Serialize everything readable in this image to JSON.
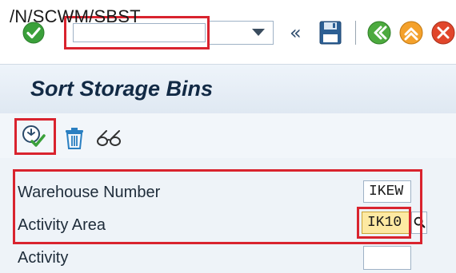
{
  "toolbar": {
    "command_value": "/N/SCWM/SBST",
    "nav_back_symbol": "«"
  },
  "title": {
    "text": "Sort Storage Bins"
  },
  "form": {
    "fields": [
      {
        "label": "Warehouse Number",
        "value": "IKEW"
      },
      {
        "label": "Activity Area",
        "value": "IK10"
      },
      {
        "label": "Activity",
        "value": ""
      }
    ]
  },
  "colors": {
    "highlight": "#d9232e",
    "ok_green": "#3aa03a",
    "focused_field": "#fde9a2",
    "title_text": "#122a45"
  },
  "icons": {
    "ok": "checkmark-circle-icon",
    "dropdown": "chevron-down-icon",
    "back": "double-chevron-left-icon",
    "save": "floppy-disk-icon",
    "back_green": "back-icon",
    "exit": "exit-icon",
    "cancel": "cancel-icon",
    "execute": "execute-icon",
    "delete": "trash-icon",
    "display": "glasses-icon",
    "search_help": "search-icon"
  }
}
